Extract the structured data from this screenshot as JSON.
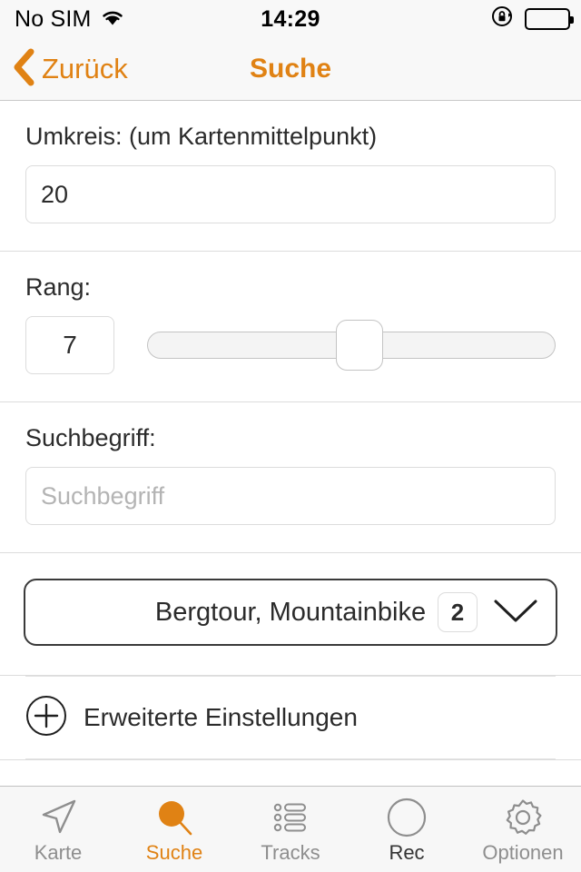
{
  "statusbar": {
    "carrier": "No SIM",
    "wifi_icon": "wifi-icon",
    "time": "14:29",
    "rotation_lock_icon": "rotation-lock-icon",
    "battery_icon": "battery-full-icon"
  },
  "navbar": {
    "back_icon": "chevron-left-icon",
    "back_label": "Zurück",
    "title": "Suche",
    "accent_color": "#E08214"
  },
  "form": {
    "umkreis": {
      "label": "Umkreis: (um Kartenmittelpunkt)",
      "value": "20",
      "placeholder": ""
    },
    "rang": {
      "label": "Rang:",
      "value": "7",
      "slider_percent": 52,
      "slider_min": 0,
      "slider_max": 100
    },
    "suchbegriff": {
      "label": "Suchbegriff:",
      "value": "",
      "placeholder": "Suchbegriff"
    },
    "category": {
      "label": "Bergtour, Mountainbike",
      "badge": "2",
      "chevron_icon": "chevron-down-icon"
    },
    "advanced": {
      "icon": "plus-circle-icon",
      "label": "Erweiterte Einstellungen"
    }
  },
  "tabbar": {
    "items": [
      {
        "label": "Karte",
        "icon": "navigation-arrow-icon",
        "state": "inactive"
      },
      {
        "label": "Suche",
        "icon": "search-icon",
        "state": "active"
      },
      {
        "label": "Tracks",
        "icon": "list-icon",
        "state": "inactive"
      },
      {
        "label": "Rec",
        "icon": "record-circle-icon",
        "state": "dark"
      },
      {
        "label": "Optionen",
        "icon": "gear-icon",
        "state": "inactive"
      }
    ]
  }
}
